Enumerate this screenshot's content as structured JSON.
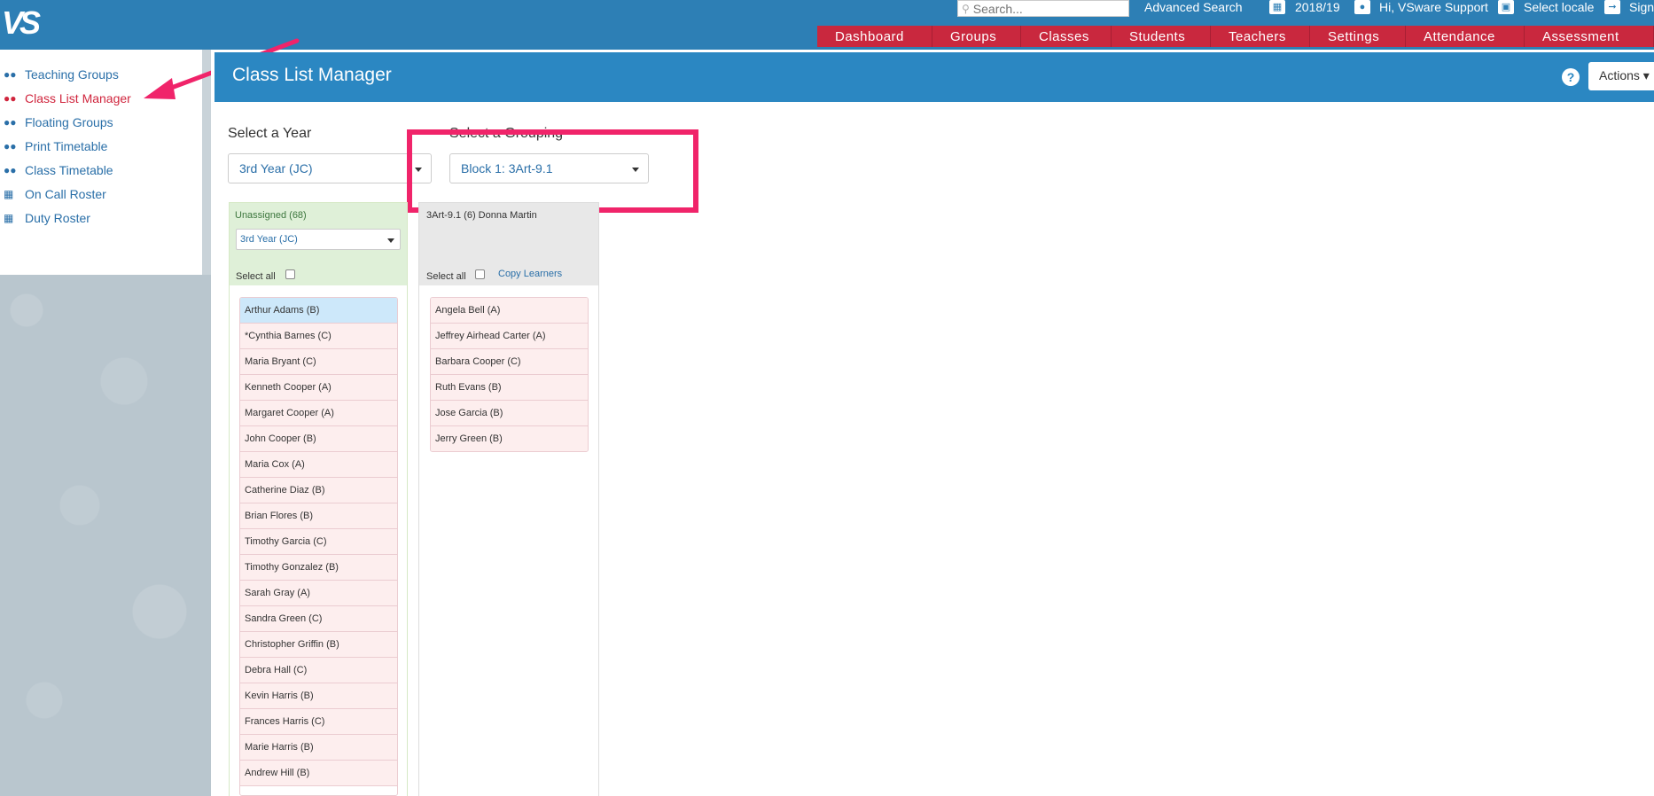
{
  "topbar": {
    "logo": "VS",
    "search_placeholder": "Search...",
    "advanced_search": "Advanced Search",
    "year": "2018/19",
    "greeting": "Hi, VSware Support",
    "locale": "Select locale",
    "sign": "Sign"
  },
  "nav": [
    "Dashboard",
    "Groups",
    "Classes",
    "Students",
    "Teachers",
    "Settings",
    "Attendance",
    "Assessment"
  ],
  "sidebar": {
    "items": [
      {
        "label": "Teaching Groups",
        "icon": "users-icon"
      },
      {
        "label": "Class List Manager",
        "icon": "users-icon",
        "active": true
      },
      {
        "label": "Floating Groups",
        "icon": "users-icon"
      },
      {
        "label": "Print Timetable",
        "icon": "users-icon"
      },
      {
        "label": "Class Timetable",
        "icon": "users-icon"
      },
      {
        "label": "On Call Roster",
        "icon": "calendar-icon"
      },
      {
        "label": "Duty Roster",
        "icon": "calendar-icon"
      }
    ]
  },
  "header": {
    "title": "Class List Manager",
    "help": "?",
    "actions": "Actions ▾"
  },
  "year_select": {
    "label": "Select a Year",
    "value": "3rd Year (JC)"
  },
  "grouping_select": {
    "label": "Select a Grouping",
    "value": "Block 1: 3Art-9.1"
  },
  "unassigned": {
    "title": "Unassigned (68)",
    "filter": "3rd Year (JC)",
    "select_all": "Select all",
    "students": [
      "Arthur Adams (B)",
      "*Cynthia Barnes (C)",
      "Maria Bryant (C)",
      "Kenneth Cooper (A)",
      "Margaret Cooper (A)",
      "John Cooper (B)",
      "Maria Cox (A)",
      "Catherine Diaz (B)",
      "Brian Flores (B)",
      "Timothy Garcia (C)",
      "Timothy Gonzalez (B)",
      "Sarah Gray (A)",
      "Sandra Green (C)",
      "Christopher Griffin (B)",
      "Debra Hall (C)",
      "Kevin Harris (B)",
      "Frances Harris (C)",
      "Marie Harris (B)",
      "Andrew Hill (B)"
    ]
  },
  "group": {
    "title": "3Art-9.1 (6) Donna Martin",
    "select_all": "Select all",
    "copy": "Copy Learners",
    "students": [
      "Angela Bell (A)",
      "Jeffrey Airhead Carter (A)",
      "Barbara Cooper (C)",
      "Ruth Evans (B)",
      "Jose Garcia (B)",
      "Jerry Green (B)"
    ]
  },
  "colors": {
    "topbar": "#2d7fb5",
    "nav": "#c9283e",
    "highlight": "#f0246a",
    "active": "#d0253d"
  }
}
